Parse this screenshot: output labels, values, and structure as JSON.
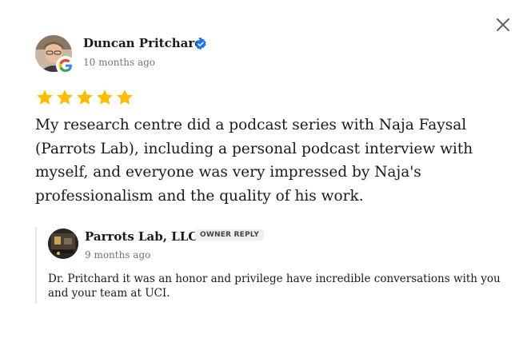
{
  "review": {
    "reviewer_name": "Duncan Pritchard",
    "time": "10 months ago",
    "rating": 5,
    "text": "My research centre did a podcast series with Naja Faysal (Parrots Lab), including a personal podcast interview with myself, and everyone was very impressed by Naja's professionalism and the quality of his work.",
    "source_icon": "google-g-icon",
    "verified_icon": "verified-badge-icon"
  },
  "reply": {
    "name": "Parrots Lab, LLC",
    "badge": "OWNER REPLY",
    "time": "9 months ago",
    "text": "Dr. Pritchard it was an honor and privilege have incredible conversations with you and your team at UCI."
  },
  "controls": {
    "close_icon": "close-icon"
  },
  "colors": {
    "star": "#fbbc04",
    "verified": "#1a73e8",
    "muted_text": "#70757a",
    "badge_bg": "#eeeeee",
    "reply_border": "#e3e3e3"
  }
}
